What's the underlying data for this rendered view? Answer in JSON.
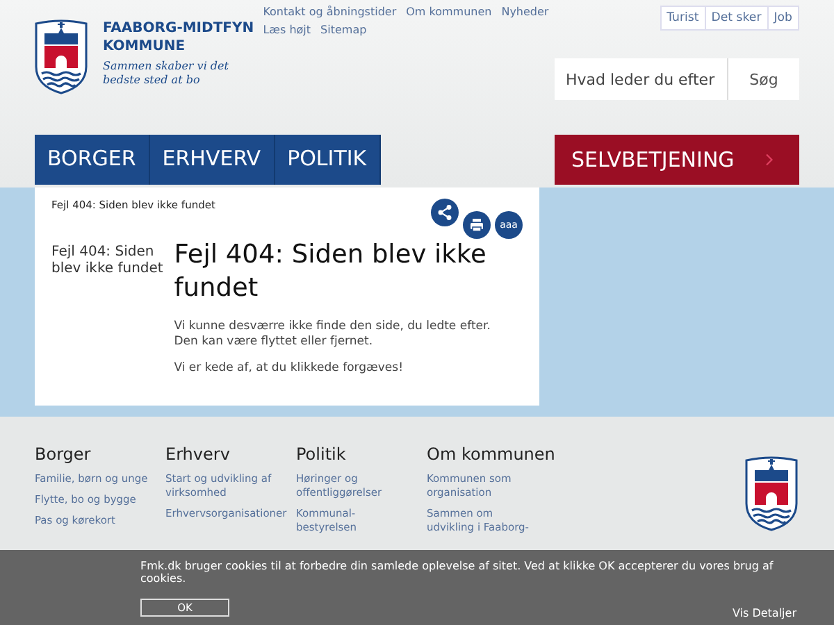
{
  "logo": {
    "name_line_1": "FAABORG-MIDTFYN",
    "name_line_2": "KOMMUNE",
    "tagline": "Sammen skaber vi det bedste sted at bo"
  },
  "top_links": [
    "Kontakt og åbningstider",
    "Om kommunen",
    "Nyheder",
    "Læs højt",
    "Sitemap"
  ],
  "site_tabs": [
    "Turist",
    "Det sker",
    "Job"
  ],
  "search": {
    "placeholder": "Hvad leder du efter",
    "button": "Søg"
  },
  "main_nav": [
    "BORGER",
    "ERHVERV",
    "POLITIK"
  ],
  "service_button": "SELVBETJENING",
  "breadcrumb": "Fejl 404: Siden blev ikke fundet",
  "side_title": "Fejl 404: Siden blev ikke fundet",
  "heading": "Fejl 404: Siden blev ikke fundet",
  "paragraphs": [
    "Vi kunne desværre ikke finde den side, du ledte efter. Den kan være flyttet eller fjernet.",
    "Vi er kede af, at du klikkede forgæves!"
  ],
  "font_size_button": "aaa",
  "footer_columns": [
    {
      "title": "Borger",
      "links": [
        "Familie, børn og unge",
        "Flytte, bo og bygge",
        "Pas og kørekort"
      ]
    },
    {
      "title": "Erhverv",
      "links": [
        "Start og udvikling af virksomhed",
        "Erhvervsorganisationer"
      ]
    },
    {
      "title": "Politik",
      "links": [
        "Høringer og offentliggørelser",
        "Kommunal-bestyrelsen"
      ]
    },
    {
      "title": "Om kommunen",
      "links": [
        "Kommunen som organisation",
        "Sammen om udvikling i Faaborg-"
      ]
    }
  ],
  "cookie": {
    "text": "Fmk.dk bruger cookies til at forbedre din samlede oplevelse af sitet. Ved at klikke OK accepterer du vores brug af cookies.",
    "ok": "OK",
    "details": "Vis Detaljer"
  }
}
